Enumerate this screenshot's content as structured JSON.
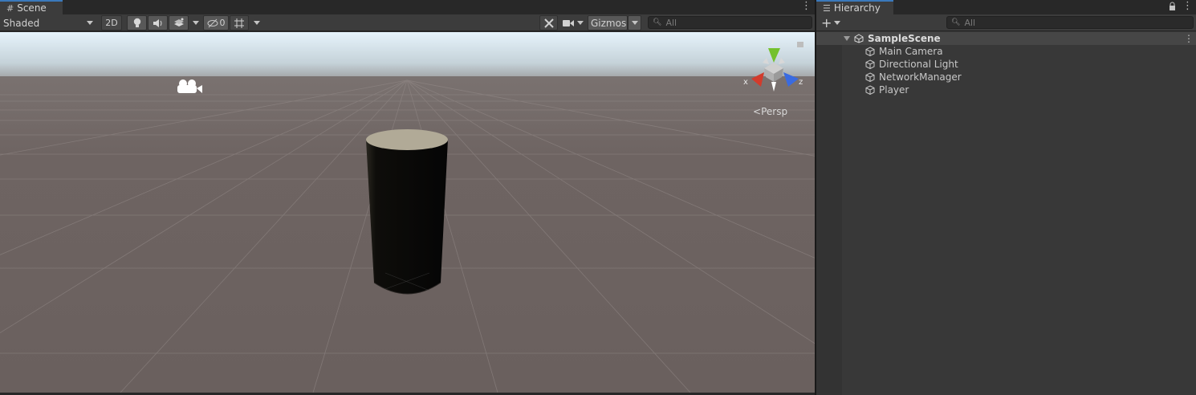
{
  "scene_panel": {
    "tab_title": "Scene",
    "shading_mode": "Shaded",
    "mode_2d_label": "2D",
    "hidden_count": "0",
    "gizmos_label": "Gizmos",
    "search_placeholder": "All",
    "gizmo_axes": {
      "y": "y",
      "x": "x",
      "z": "z"
    },
    "projection_label": "Persp",
    "colors": {
      "ground": "#6b605e",
      "sky": "#eaf4fa",
      "accent_tab": "#3a79bb",
      "axis_x": "#d23b2c",
      "axis_y": "#74c12c",
      "axis_z": "#3a6be0"
    }
  },
  "hierarchy_panel": {
    "tab_title": "Hierarchy",
    "search_placeholder": "All",
    "scene_name": "SampleScene",
    "items": [
      {
        "label": "Main Camera",
        "icon": "gameobject-cube-icon"
      },
      {
        "label": "Directional Light",
        "icon": "gameobject-cube-icon"
      },
      {
        "label": "NetworkManager",
        "icon": "gameobject-cube-icon"
      },
      {
        "label": "Player",
        "icon": "gameobject-cube-icon"
      }
    ]
  }
}
